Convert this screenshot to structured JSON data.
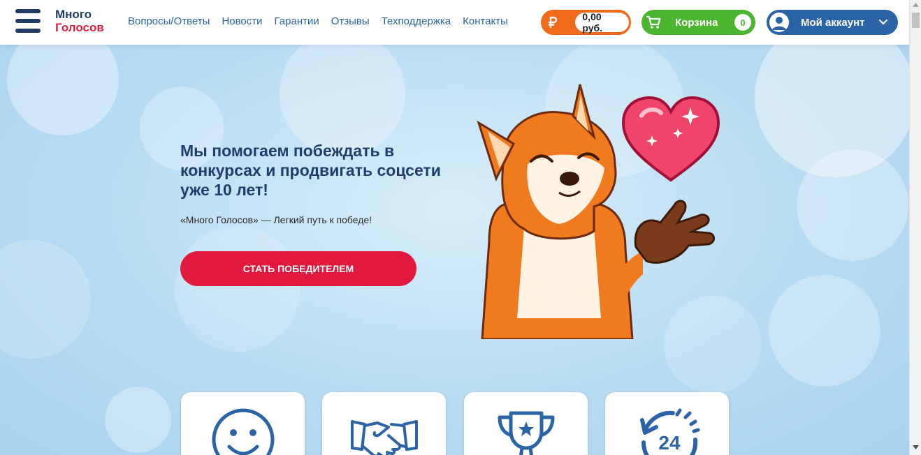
{
  "header": {
    "logo_line1": "Много",
    "logo_line2": "Голосов",
    "nav": [
      "Вопросы/Ответы",
      "Новости",
      "Гарантии",
      "Отзывы",
      "Техподдержка",
      "Контакты"
    ],
    "balance": "0,00 руб.",
    "cart_label": "Корзина",
    "cart_count": "0",
    "account_label": "Мой аккаунт"
  },
  "hero": {
    "title": "Мы помогаем побеждать в конкурсах и продвигать соцсети уже 10 лет!",
    "subtitle": "«Много Голосов» — Легкий путь к победе!",
    "cta": "СТАТЬ ПОБЕДИТЕЛЕМ"
  },
  "features": {
    "card1_icon": "smile-icon",
    "card2_icon": "handshake-icon",
    "card3_icon": "trophy-icon",
    "card4_icon": "clock-24-icon",
    "card4_text": "24"
  },
  "colors": {
    "brand_blue": "#223c65",
    "link_blue": "#2a64a6",
    "brand_red": "#e1193e",
    "balance_orange": "#f06a1a",
    "cart_green": "#4cb530"
  }
}
